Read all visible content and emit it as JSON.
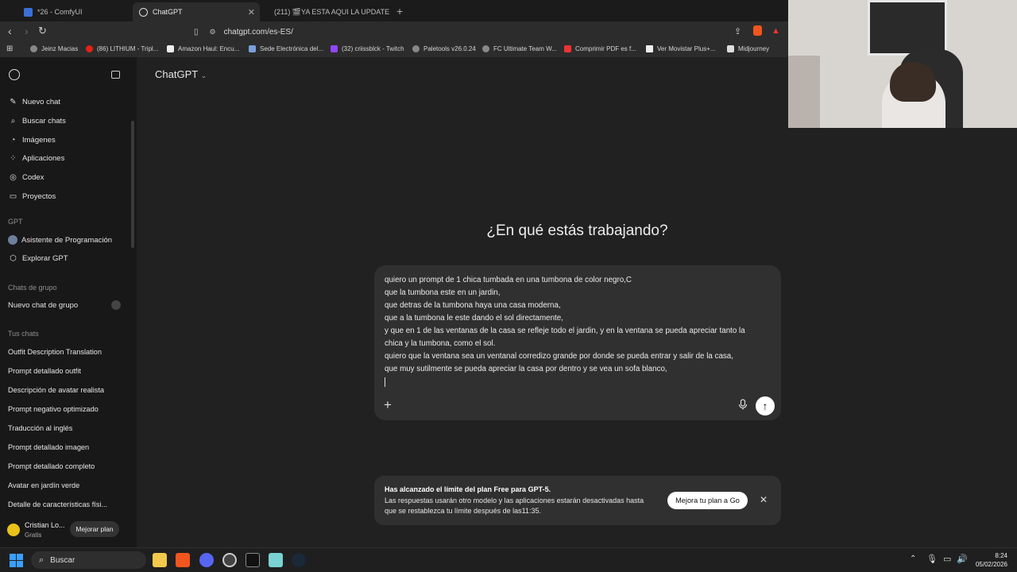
{
  "browser": {
    "tabs": [
      {
        "label": "*26 - ComfyUI"
      },
      {
        "label": "ChatGPT"
      },
      {
        "label": "(211) 🎬YA ESTA AQUI LA UPDATE A"
      }
    ],
    "url": "chatgpt.com/es-ES/",
    "bookmarks": [
      "Jeinz Macias",
      "(86) LITHIUM - Tripl...",
      "Amazon Haul: Encu...",
      "Sede Electrónica del...",
      "(32) criissblck - Twitch",
      "Paletools v26.0.24",
      "FC Ultimate Team W...",
      "Comprimir PDF es f...",
      "Ver Movistar Plus+...",
      "Midjourney"
    ]
  },
  "sidebar": {
    "top_items": [
      {
        "label": "Nuevo chat",
        "icon": "edit-icon"
      },
      {
        "label": "Buscar chats",
        "icon": "search-icon"
      },
      {
        "label": "Imágenes",
        "icon": "image-icon"
      },
      {
        "label": "Aplicaciones",
        "icon": "apps-icon"
      },
      {
        "label": "Codex",
        "icon": "codex-icon"
      },
      {
        "label": "Proyectos",
        "icon": "folder-icon"
      }
    ],
    "gpt_header": "GPT",
    "gpt_items": [
      {
        "label": "Asistente de Programación"
      },
      {
        "label": "Explorar GPT"
      }
    ],
    "group_header": "Chats de grupo",
    "group_item": "Nuevo chat de grupo",
    "chats_header": "Tus chats",
    "chats": [
      "Outfit Description Translation",
      "Prompt detallado outfit",
      "Descripción de avatar realista",
      "Prompt negativo optimizado",
      "Traducción al inglés",
      "Prompt detallado imagen",
      "Prompt detallado completo",
      "Avatar en jardín verde",
      "Detalle de características físi..."
    ],
    "user": {
      "name": "Cristian Lo...",
      "plan": "Gratis",
      "upgrade": "Mejorar plan"
    }
  },
  "main": {
    "model_label": "ChatGPT",
    "heading": "¿En qué estás trabajando?",
    "composer_lines": [
      "quiero un prompt de 1 chica tumbada en una tumbona de color negro,C",
      "que la tumbona este en un jardin,",
      "que detras de la tumbona haya una casa moderna,",
      "que a la tumbona le este dando el sol directamente,",
      "y que en 1 de las ventanas de la casa se refleje todo el jardin, y en la ventana se pueda apreciar tanto la",
      "chica y la tumbona, como el sol.",
      "quiero que la ventana sea un ventanal corredizo grande por donde se pueda entrar y salir de la casa,",
      "que muy sutilmente se pueda apreciar la casa por dentro y se vea un sofa blanco,"
    ]
  },
  "limit_notice": {
    "title": "Has alcanzado el límite del plan Free para GPT-5.",
    "line1": "Las respuestas usarán otro modelo y las aplicaciones estarán desactivadas hasta",
    "line2": "que se restablezca tu límite después de las11:35.",
    "button": "Mejora tu plan a Go"
  },
  "taskbar": {
    "search": "Buscar",
    "time": "8:24",
    "date": "05/02/2026"
  }
}
